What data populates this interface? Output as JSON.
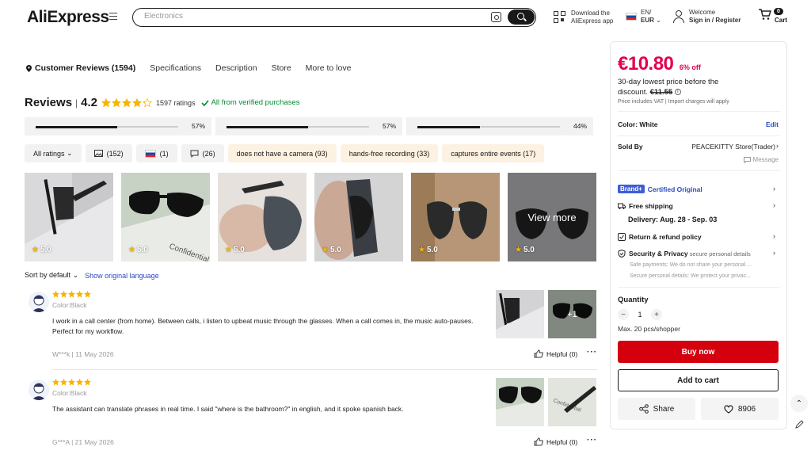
{
  "header": {
    "logo": "AliExpress",
    "search_placeholder": "Electronics",
    "app_line1": "Download the",
    "app_line2": "AliExpress app",
    "lang_line1": "EN/",
    "lang_line2": "EUR",
    "welcome": "Welcome",
    "signin": "Sign in / Register",
    "cart_count": "0",
    "cart_label": "Cart"
  },
  "tabs": [
    {
      "label": "Customer Reviews (1594)"
    },
    {
      "label": "Specifications"
    },
    {
      "label": "Description"
    },
    {
      "label": "Store"
    },
    {
      "label": "More to love"
    }
  ],
  "reviews": {
    "title": "Reviews",
    "score": "4.2",
    "ratings_count": "1597 ratings",
    "verified": "All from verified purchases",
    "stars_filled": 4.2,
    "bars": [
      {
        "pct_label": "57%",
        "fill": 0.57
      },
      {
        "pct_label": "57%",
        "fill": 0.57
      },
      {
        "pct_label": "44%",
        "fill": 0.44
      }
    ],
    "filters": {
      "all": "All ratings",
      "photos": "(152)",
      "flag": "(1)",
      "comments": "(26)",
      "tag1": "does not have a camera (93)",
      "tag2": "hands-free recording (33)",
      "tag3": "captures entire events (17)"
    },
    "photo_ratings": [
      "5.0",
      "5.0",
      "5.0",
      "5.0",
      "5.0",
      "5.0"
    ],
    "view_more": "View more",
    "sort": "Sort by default",
    "show_original": "Show original language",
    "items": [
      {
        "color": "Color:Black",
        "text": "I work in a call center (from home). Between calls, i listen to upbeat music through the glasses. When a call comes in, the music auto-pauses. Perfect for my workflow.",
        "meta": "W***k | 11 May 2026",
        "helpful": "Helpful (0)",
        "more_photos": "+1"
      },
      {
        "color": "Color:Black",
        "text": "The assistant can translate phrases in real time. I said \"where is the bathroom?\" in english, and it spoke spanish back.",
        "meta": "G***A | 21 May 2026",
        "helpful": "Helpful (0)"
      }
    ]
  },
  "panel": {
    "price": "€10.80",
    "discount": "6% off",
    "lowest_prefix": "30-day lowest price before the discount.",
    "lowest_price": "€11.55",
    "vat": "Price includes VAT | Import charges will apply",
    "color_label": "Color: White",
    "edit": "Edit",
    "sold_by": "Sold By",
    "store": "PEACEKITTY Store(Trader)",
    "message": "Message",
    "brand_badge": "Brand+",
    "brand_text": "Certified Original",
    "free_shipping": "Free shipping",
    "delivery": "Delivery: Aug. 28 - Sep. 03",
    "return_policy": "Return & refund policy",
    "security": "Security & Privacy",
    "security_sub": "secure personal details",
    "safe_payments": "Safe payments: We do not share your personal ...",
    "secure_details": "Secure personal details: We protect your privac...",
    "quantity_label": "Quantity",
    "quantity": "1",
    "max": "Max. 20 pcs/shopper",
    "buy_now": "Buy now",
    "add_to_cart": "Add to cart",
    "share": "Share",
    "likes": "8906"
  },
  "colors": {
    "price_red": "#e4004b",
    "buy_red": "#d4000e",
    "link_blue": "#2b4ac2",
    "verified_green": "#008a30",
    "star_gold": "#f7b500"
  }
}
